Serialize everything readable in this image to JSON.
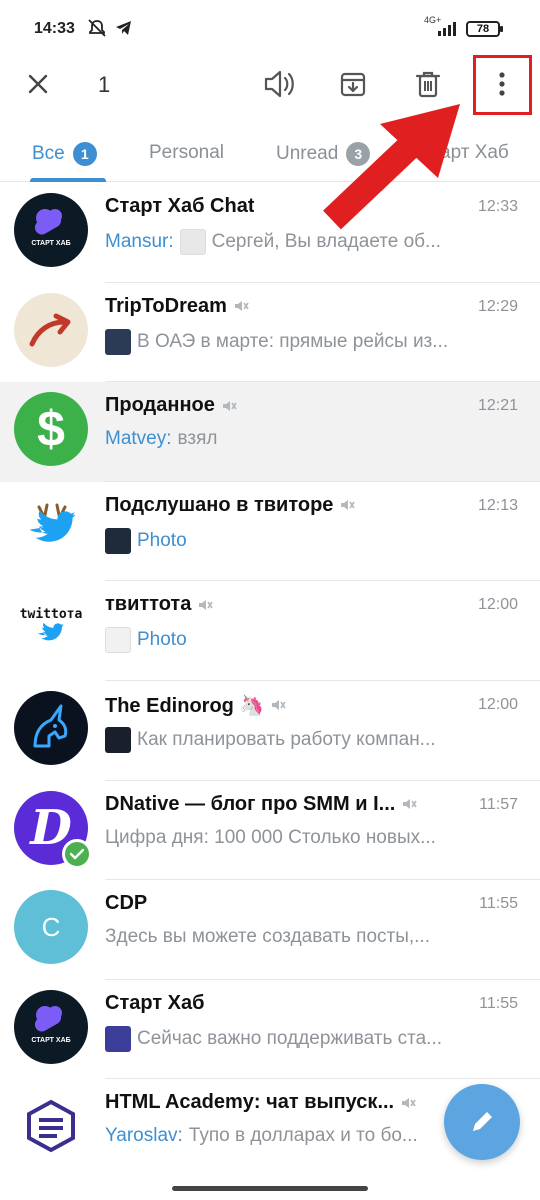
{
  "status_bar": {
    "time": "14:33",
    "network": "4G+",
    "battery": "78"
  },
  "action_bar": {
    "selected_count": "1"
  },
  "tabs": [
    {
      "label": "Все",
      "badge": "1"
    },
    {
      "label": "Personal",
      "badge": ""
    },
    {
      "label": "Unread",
      "badge": "3"
    },
    {
      "label": "арт Хаб",
      "badge": ""
    }
  ],
  "chats": [
    {
      "name": "Старт Хаб Chat",
      "time": "12:33",
      "sender": "Mansur:",
      "message": "Сергей, Вы владаете об...",
      "avatar_text": "СТАРТ ХАБ"
    },
    {
      "name": "TripToDream",
      "time": "12:29",
      "sender": "",
      "message": "В ОАЭ в марте: прямые рейсы из..."
    },
    {
      "name": "Проданное",
      "time": "12:21",
      "sender": "Matvey:",
      "message": "взял",
      "avatar_text": "$"
    },
    {
      "name": "Подслушано в твиторе",
      "time": "12:13",
      "sender": "",
      "message": "Photo"
    },
    {
      "name": "твиттота",
      "time": "12:00",
      "sender": "",
      "message": "Photo",
      "avatar_text": "twittота"
    },
    {
      "name": "The Edinorog 🦄",
      "time": "12:00",
      "sender": "",
      "message": "Как планировать работу компан..."
    },
    {
      "name": "DNative — блог про SMM и I...",
      "time": "11:57",
      "sender": "",
      "message": "Цифра дня: 100 000   Столько новых..."
    },
    {
      "name": "CDP",
      "time": "11:55",
      "sender": "",
      "message": "Здесь вы можете создавать посты,...",
      "avatar_text": "C"
    },
    {
      "name": "Старт Хаб",
      "time": "11:55",
      "sender": "",
      "message": "Сейчас важно поддерживать ста...",
      "avatar_text": "СТАРТ ХАБ"
    },
    {
      "name": "HTML Academy: чат выпуск...",
      "time": "",
      "sender": "Yaroslav:",
      "message": "Тупо в долларах и то бо..."
    }
  ],
  "colors": {
    "accent": "#3d8fd1",
    "fab": "#5ca5e0",
    "annotation": "#e02020"
  }
}
